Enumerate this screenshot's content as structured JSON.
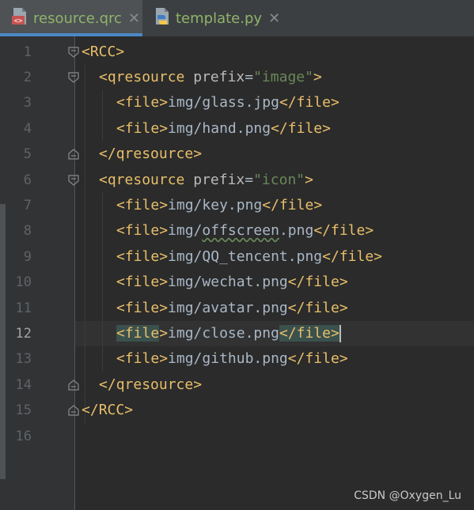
{
  "tabs": [
    {
      "label": "resource.qrc",
      "icon": "qrc-file-icon",
      "active": true,
      "close": "✕"
    },
    {
      "label": "template.py",
      "icon": "python-file-icon",
      "active": false,
      "close": "✕"
    }
  ],
  "lines": [
    {
      "num": "1",
      "t1": "<",
      "tag": "RCC",
      "t2": ">"
    },
    {
      "num": "2",
      "t1": "<",
      "tag": "qresource",
      "attr": " prefix",
      "eq": "=",
      "val": "\"image\"",
      "t2": ">"
    },
    {
      "num": "3",
      "o1": "<",
      "otag": "file",
      "o2": ">",
      "text": "img/glass.jpg",
      "c1": "</",
      "ctag": "file",
      "c2": ">"
    },
    {
      "num": "4",
      "o1": "<",
      "otag": "file",
      "o2": ">",
      "text": "img/hand.png",
      "c1": "</",
      "ctag": "file",
      "c2": ">"
    },
    {
      "num": "5",
      "t1": "</",
      "tag": "qresource",
      "t2": ">"
    },
    {
      "num": "6",
      "t1": "<",
      "tag": "qresource",
      "attr": " prefix",
      "eq": "=",
      "val": "\"icon\"",
      "t2": ">"
    },
    {
      "num": "7",
      "o1": "<",
      "otag": "file",
      "o2": ">",
      "text": "img/key.png",
      "c1": "</",
      "ctag": "file",
      "c2": ">"
    },
    {
      "num": "8",
      "o1": "<",
      "otag": "file",
      "o2": ">",
      "text_a": "img/",
      "text_b": "offscreen",
      "text_c": ".png",
      "c1": "</",
      "ctag": "file",
      "c2": ">"
    },
    {
      "num": "9",
      "o1": "<",
      "otag": "file",
      "o2": ">",
      "text": "img/QQ_tencent.png",
      "c1": "</",
      "ctag": "file",
      "c2": ">"
    },
    {
      "num": "10",
      "o1": "<",
      "otag": "file",
      "o2": ">",
      "text": "img/wechat.png",
      "c1": "</",
      "ctag": "file",
      "c2": ">"
    },
    {
      "num": "11",
      "o1": "<",
      "otag": "file",
      "o2": ">",
      "text": "img/avatar.png",
      "c1": "</",
      "ctag": "file",
      "c2": ">"
    },
    {
      "num": "12",
      "o1": "<",
      "otag": "file",
      "o2": ">",
      "text": "img/close.png",
      "c1": "</",
      "ctag": "file",
      "c2": ">"
    },
    {
      "num": "13",
      "o1": "<",
      "otag": "file",
      "o2": ">",
      "text": "img/github.png",
      "c1": "</",
      "ctag": "file",
      "c2": ">"
    },
    {
      "num": "14",
      "t1": "</",
      "tag": "qresource",
      "t2": ">"
    },
    {
      "num": "15",
      "t1": "</",
      "tag": "RCC",
      "t2": ">"
    },
    {
      "num": "16"
    }
  ],
  "current_line": "12",
  "watermark": "CSDN @Oxygen_Lu",
  "colors": {
    "background": "#2b2b2b",
    "gutter": "#313335",
    "tag": "#e8bf6a",
    "attr": "#bababa",
    "string": "#6a8759",
    "text": "#a9b7c6",
    "tab_label": "#8fb36b",
    "tab_underline": "#4a88c7"
  }
}
